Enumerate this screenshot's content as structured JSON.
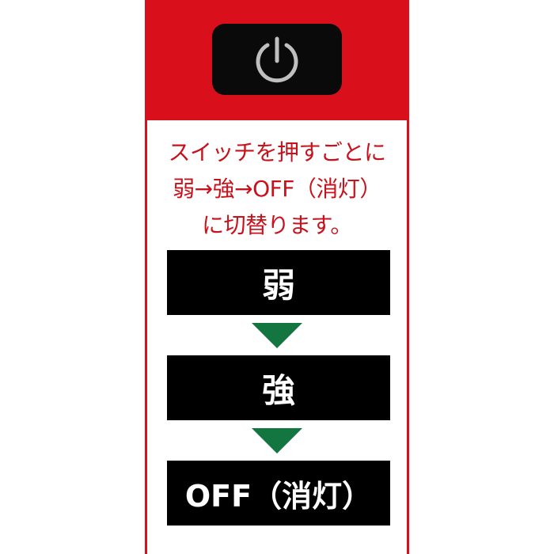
{
  "instruction": {
    "line1": "スイッチを押すごとに",
    "line2": "弱→強→OFF（消灯）",
    "line3": "に切替ります。"
  },
  "modes": [
    {
      "label": "弱"
    },
    {
      "label": "強"
    },
    {
      "label": "OFF（消灯）"
    }
  ],
  "icons": {
    "switch": "power-icon",
    "step": "down-triangle-icon"
  },
  "colors": {
    "panel": "#d9101c",
    "instruction_text": "#c8121b",
    "mode_box": "#000000",
    "arrow": "#137540",
    "power_symbol": "#bfbfbf"
  }
}
